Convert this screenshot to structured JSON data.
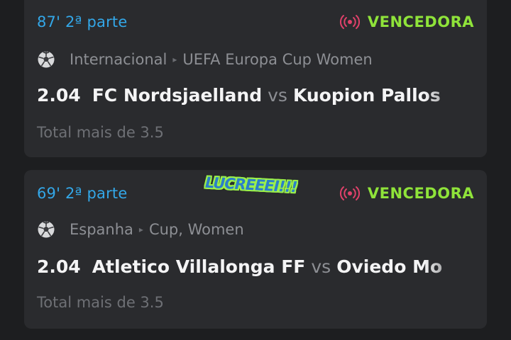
{
  "bets": [
    {
      "time": "87' 2ª parte",
      "status": "VENCEDORA",
      "country": "Internacional",
      "league": "UEFA Europa Cup Women",
      "odd": "2.04",
      "home_team": "FC Nordsjaelland",
      "vs": "vs",
      "away_team": "Kuopion Pallos",
      "market": "Total mais de 3.5"
    },
    {
      "time": "69' 2ª parte",
      "status": "VENCEDORA",
      "country": "Espanha",
      "league": "Cup, Women",
      "odd": "2.04",
      "home_team": "Atletico Villalonga FF",
      "vs": "vs",
      "away_team": "Oviedo Mo",
      "market": "Total mais de 3.5"
    }
  ],
  "sticker": "LUCREEEI!!!",
  "colors": {
    "background": "#1d1e20",
    "card": "#2a2b2e",
    "time": "#33a7e8",
    "status_win": "#8fe33a",
    "live_icon": "#e0416a"
  },
  "icons": {
    "sport": "soccer-ball-icon",
    "live": "live-broadcast-icon",
    "separator": "chevron-right-icon"
  }
}
